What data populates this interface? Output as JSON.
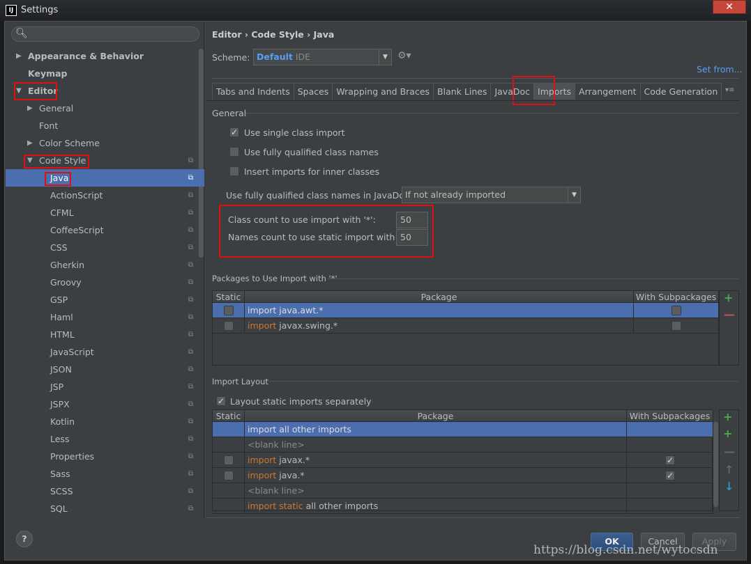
{
  "window": {
    "title": "Settings",
    "app_icon": "IJ"
  },
  "sidebar": {
    "search_placeholder": "",
    "items": [
      {
        "label": "Appearance & Behavior",
        "expanded": false
      },
      {
        "label": "Keymap"
      },
      {
        "label": "Editor",
        "expanded": true
      },
      {
        "label": "General",
        "expanded": false
      },
      {
        "label": "Font"
      },
      {
        "label": "Color Scheme",
        "expanded": false
      },
      {
        "label": "Code Style",
        "expanded": true
      },
      {
        "label": "Java",
        "selected": true
      },
      {
        "label": "ActionScript"
      },
      {
        "label": "CFML"
      },
      {
        "label": "CoffeeScript"
      },
      {
        "label": "CSS"
      },
      {
        "label": "Gherkin"
      },
      {
        "label": "Groovy"
      },
      {
        "label": "GSP"
      },
      {
        "label": "Haml"
      },
      {
        "label": "HTML"
      },
      {
        "label": "JavaScript"
      },
      {
        "label": "JSON"
      },
      {
        "label": "JSP"
      },
      {
        "label": "JSPX"
      },
      {
        "label": "Kotlin"
      },
      {
        "label": "Less"
      },
      {
        "label": "Properties"
      },
      {
        "label": "Sass"
      },
      {
        "label": "SCSS"
      },
      {
        "label": "SQL"
      }
    ]
  },
  "breadcrumb": [
    "Editor",
    "Code Style",
    "Java"
  ],
  "scheme": {
    "label": "Scheme:",
    "name": "Default",
    "type": "IDE",
    "set_from": "Set from..."
  },
  "tabs": [
    "Tabs and Indents",
    "Spaces",
    "Wrapping and Braces",
    "Blank Lines",
    "JavaDoc",
    "Imports",
    "Arrangement",
    "Code Generation"
  ],
  "active_tab": "Imports",
  "general": {
    "title": "General",
    "options": [
      {
        "label": "Use single class import",
        "checked": true
      },
      {
        "label": "Use fully qualified class names",
        "checked": false
      },
      {
        "label": "Insert imports for inner classes",
        "checked": false
      }
    ],
    "javadoc_label": "Use fully qualified class names in JavaDoc:",
    "javadoc_value": "If not already imported",
    "class_count_label": "Class count to use import with '*':",
    "class_count": "50",
    "names_count_label": "Names count to use static import with '*':",
    "names_count": "50"
  },
  "packages": {
    "title": "Packages to Use Import with '*'",
    "columns": [
      "Static",
      "Package",
      "With Subpackages"
    ],
    "rows": [
      {
        "static": false,
        "keyword": "import",
        "package": "java.awt.*",
        "sub": false,
        "selected": true
      },
      {
        "static": false,
        "keyword": "import",
        "package": "javax.swing.*",
        "sub": false
      }
    ]
  },
  "layout": {
    "title": "Import Layout",
    "separate_label": "Layout static imports separately",
    "separate_checked": true,
    "columns": [
      "Static",
      "Package",
      "With Subpackages"
    ],
    "rows": [
      {
        "keyword": "",
        "text": "import all other imports",
        "selected": true
      },
      {
        "keyword": "",
        "text": "<blank line>",
        "blank": true
      },
      {
        "static": false,
        "keyword": "import",
        "text": "javax.*",
        "sub": true
      },
      {
        "static": false,
        "keyword": "import",
        "text": "java.*",
        "sub": true
      },
      {
        "keyword": "",
        "text": "<blank line>",
        "blank": true
      },
      {
        "keyword": "import static",
        "text": "all other imports"
      }
    ]
  },
  "buttons": {
    "ok": "OK",
    "cancel": "Cancel",
    "apply": "Apply",
    "help": "?"
  },
  "watermark": "https://blog.csdn.net/wytocsdn",
  "colors": {
    "selection": "#4b6eaf",
    "keyword": "#cc7832",
    "highlight": "#e01010",
    "link": "#589df6"
  }
}
